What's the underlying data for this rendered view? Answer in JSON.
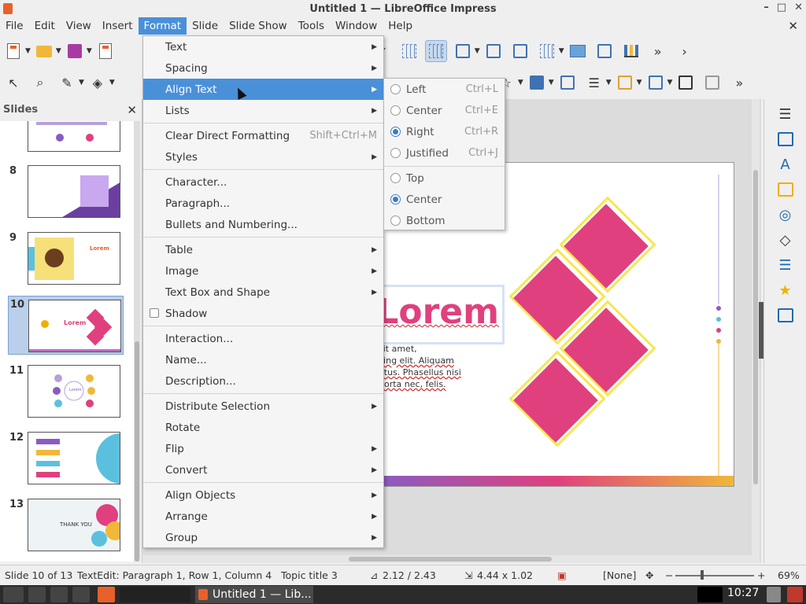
{
  "window": {
    "title": "Untitled 1 — LibreOffice Impress"
  },
  "menubar": {
    "items": [
      "File",
      "Edit",
      "View",
      "Insert",
      "Format",
      "Slide",
      "Slide Show",
      "Tools",
      "Window",
      "Help"
    ],
    "active": "Format"
  },
  "slides_pane": {
    "title": "Slides",
    "slides": [
      {
        "number": "8"
      },
      {
        "number": "9",
        "text": "Lorem"
      },
      {
        "number": "10",
        "text": "Lorem",
        "current": true
      },
      {
        "number": "11",
        "text": "Lorem"
      },
      {
        "number": "12"
      },
      {
        "number": "13",
        "text": "THANK YOU"
      }
    ]
  },
  "format_menu": {
    "items": [
      {
        "label": "Text",
        "submenu": true
      },
      {
        "label": "Spacing",
        "submenu": true
      },
      {
        "label": "Align Text",
        "submenu": true,
        "highlighted": true
      },
      {
        "label": "Lists",
        "submenu": true
      },
      {
        "label": "Clear Direct Formatting",
        "shortcut": "Shift+Ctrl+M"
      },
      {
        "label": "Styles",
        "submenu": true
      },
      {
        "label": "Character..."
      },
      {
        "label": "Paragraph..."
      },
      {
        "label": "Bullets and Numbering..."
      },
      {
        "label": "Table",
        "submenu": true
      },
      {
        "label": "Image",
        "submenu": true
      },
      {
        "label": "Text Box and Shape",
        "submenu": true
      },
      {
        "label": "Shadow",
        "checkbox": true
      },
      {
        "label": "Interaction..."
      },
      {
        "label": "Name..."
      },
      {
        "label": "Description..."
      },
      {
        "label": "Distribute Selection",
        "submenu": true
      },
      {
        "label": "Rotate"
      },
      {
        "label": "Flip",
        "submenu": true
      },
      {
        "label": "Convert",
        "submenu": true
      },
      {
        "label": "Align Objects",
        "submenu": true
      },
      {
        "label": "Arrange",
        "submenu": true
      },
      {
        "label": "Group",
        "submenu": true
      }
    ]
  },
  "align_submenu": {
    "items": [
      {
        "label": "Left",
        "shortcut": "Ctrl+L",
        "selected": false
      },
      {
        "label": "Center",
        "shortcut": "Ctrl+E",
        "selected": false
      },
      {
        "label": "Right",
        "shortcut": "Ctrl+R",
        "selected": true
      },
      {
        "label": "Justified",
        "shortcut": "Ctrl+J",
        "selected": false
      },
      {
        "label": "Top",
        "selected": false
      },
      {
        "label": "Center",
        "selected": true
      },
      {
        "label": "Bottom",
        "selected": false
      }
    ]
  },
  "slide_content": {
    "title": "Lorem",
    "body_lines": [
      "sit amet,",
      "cing elit. Aliquam",
      "etus. Phasellus nisi",
      "porta nec, felis."
    ]
  },
  "statusbar": {
    "slide": "Slide 10 of 13",
    "edit_status": "TextEdit: Paragraph 1, Row 1, Column 4",
    "layout": "Topic title 3",
    "position": "2.12 / 2.43",
    "size": "4.44 x 1.02",
    "language": "[None]",
    "zoom": "69%"
  },
  "taskbar": {
    "app_label": "Untitled 1 — Lib...",
    "clock": "10:27"
  },
  "colors": {
    "accent": "#4a90d9",
    "pink": "#e0407e",
    "yellow": "#f6e84a"
  }
}
